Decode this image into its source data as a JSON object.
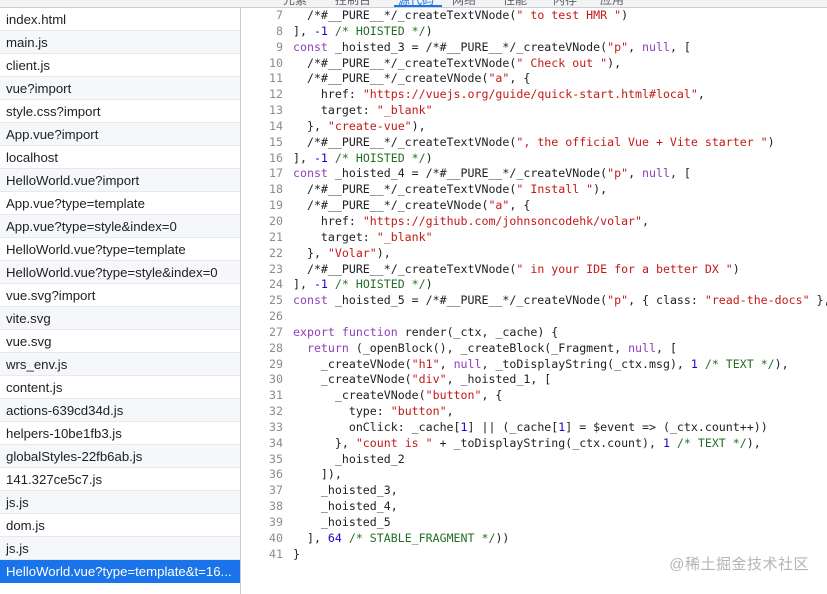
{
  "tabs": [
    {
      "label": "元素",
      "active": false
    },
    {
      "label": "控制台",
      "active": false
    },
    {
      "label": "源代码",
      "active": true
    },
    {
      "label": "网络",
      "active": false
    },
    {
      "label": "性能",
      "active": false
    },
    {
      "label": "内存",
      "active": false
    },
    {
      "label": "应用",
      "active": false
    }
  ],
  "sidebar": {
    "files": [
      "index.html",
      "main.js",
      "client.js",
      "vue?import",
      "style.css?import",
      "App.vue?import",
      "localhost",
      "HelloWorld.vue?import",
      "App.vue?type=template",
      "App.vue?type=style&index=0",
      "HelloWorld.vue?type=template",
      "HelloWorld.vue?type=style&index=0",
      "vue.svg?import",
      "vite.svg",
      "vue.svg",
      "wrs_env.js",
      "content.js",
      "actions-639cd34d.js",
      "helpers-10be1fb3.js",
      "globalStyles-22fb6ab.js",
      "141.327ce5c7.js",
      "js.js",
      "dom.js",
      "js.js",
      "HelloWorld.vue?type=template&t=16..."
    ],
    "selected_index": 24
  },
  "editor": {
    "lines": [
      {
        "n": "7",
        "seg": [
          [
            "  /*#__PURE__*/_createTextVNode(",
            "p"
          ],
          [
            "\" to test HMR \"",
            "s"
          ],
          [
            ")",
            "p"
          ]
        ]
      },
      {
        "n": "8",
        "seg": [
          [
            "], ",
            "p"
          ],
          [
            "-1",
            "n"
          ],
          [
            " /* HOISTED */",
            "c"
          ],
          [
            ")",
            "p"
          ]
        ]
      },
      {
        "n": "9",
        "seg": [
          [
            "const",
            "k"
          ],
          [
            " _hoisted_3 = /*#__PURE__*/_createVNode(",
            "p"
          ],
          [
            "\"p\"",
            "s"
          ],
          [
            ", ",
            "p"
          ],
          [
            "null",
            "k"
          ],
          [
            ", [",
            "p"
          ]
        ]
      },
      {
        "n": "10",
        "seg": [
          [
            "  /*#__PURE__*/_createTextVNode(",
            "p"
          ],
          [
            "\" Check out \"",
            "s"
          ],
          [
            "),",
            "p"
          ]
        ]
      },
      {
        "n": "11",
        "seg": [
          [
            "  /*#__PURE__*/_createVNode(",
            "p"
          ],
          [
            "\"a\"",
            "s"
          ],
          [
            ", {",
            "p"
          ]
        ]
      },
      {
        "n": "12",
        "seg": [
          [
            "    href: ",
            "p"
          ],
          [
            "\"https://vuejs.org/guide/quick-start.html#local\"",
            "s"
          ],
          [
            ",",
            "p"
          ]
        ]
      },
      {
        "n": "13",
        "seg": [
          [
            "    target: ",
            "p"
          ],
          [
            "\"_blank\"",
            "s"
          ]
        ]
      },
      {
        "n": "14",
        "seg": [
          [
            "  }, ",
            "p"
          ],
          [
            "\"create-vue\"",
            "s"
          ],
          [
            "),",
            "p"
          ]
        ]
      },
      {
        "n": "15",
        "seg": [
          [
            "  /*#__PURE__*/_createTextVNode(",
            "p"
          ],
          [
            "\", the official Vue + Vite starter \"",
            "s"
          ],
          [
            ")",
            "p"
          ]
        ]
      },
      {
        "n": "16",
        "seg": [
          [
            "], ",
            "p"
          ],
          [
            "-1",
            "n"
          ],
          [
            " /* HOISTED */",
            "c"
          ],
          [
            ")",
            "p"
          ]
        ]
      },
      {
        "n": "17",
        "seg": [
          [
            "const",
            "k"
          ],
          [
            " _hoisted_4 = /*#__PURE__*/_createVNode(",
            "p"
          ],
          [
            "\"p\"",
            "s"
          ],
          [
            ", ",
            "p"
          ],
          [
            "null",
            "k"
          ],
          [
            ", [",
            "p"
          ]
        ]
      },
      {
        "n": "18",
        "seg": [
          [
            "  /*#__PURE__*/_createTextVNode(",
            "p"
          ],
          [
            "\" Install \"",
            "s"
          ],
          [
            "),",
            "p"
          ]
        ]
      },
      {
        "n": "19",
        "seg": [
          [
            "  /*#__PURE__*/_createVNode(",
            "p"
          ],
          [
            "\"a\"",
            "s"
          ],
          [
            ", {",
            "p"
          ]
        ]
      },
      {
        "n": "20",
        "seg": [
          [
            "    href: ",
            "p"
          ],
          [
            "\"https://github.com/johnsoncodehk/volar\"",
            "s"
          ],
          [
            ",",
            "p"
          ]
        ]
      },
      {
        "n": "21",
        "seg": [
          [
            "    target: ",
            "p"
          ],
          [
            "\"_blank\"",
            "s"
          ]
        ]
      },
      {
        "n": "22",
        "seg": [
          [
            "  }, ",
            "p"
          ],
          [
            "\"Volar\"",
            "s"
          ],
          [
            "),",
            "p"
          ]
        ]
      },
      {
        "n": "23",
        "seg": [
          [
            "  /*#__PURE__*/_createTextVNode(",
            "p"
          ],
          [
            "\" in your IDE for a better DX \"",
            "s"
          ],
          [
            ")",
            "p"
          ]
        ]
      },
      {
        "n": "24",
        "seg": [
          [
            "], ",
            "p"
          ],
          [
            "-1",
            "n"
          ],
          [
            " /* HOISTED */",
            "c"
          ],
          [
            ")",
            "p"
          ]
        ]
      },
      {
        "n": "25",
        "seg": [
          [
            "const",
            "k"
          ],
          [
            " _hoisted_5 = /*#__PURE__*/_createVNode(",
            "p"
          ],
          [
            "\"p\"",
            "s"
          ],
          [
            ", { class: ",
            "p"
          ],
          [
            "\"read-the-docs\"",
            "s"
          ],
          [
            " },",
            "p"
          ]
        ]
      },
      {
        "n": "26",
        "seg": []
      },
      {
        "n": "27",
        "seg": [
          [
            "export",
            "k"
          ],
          [
            " ",
            "p"
          ],
          [
            "function",
            "k"
          ],
          [
            " render(_ctx, _cache) {",
            "p"
          ]
        ]
      },
      {
        "n": "28",
        "seg": [
          [
            "  ",
            "p"
          ],
          [
            "return",
            "k"
          ],
          [
            " (_openBlock(), _createBlock(_Fragment, ",
            "p"
          ],
          [
            "null",
            "k"
          ],
          [
            ", [",
            "p"
          ]
        ]
      },
      {
        "n": "29",
        "seg": [
          [
            "    _createVNode(",
            "p"
          ],
          [
            "\"h1\"",
            "s"
          ],
          [
            ", ",
            "p"
          ],
          [
            "null",
            "k"
          ],
          [
            ", _toDisplayString(_ctx.msg), ",
            "p"
          ],
          [
            "1",
            "n"
          ],
          [
            " /* TEXT */",
            "c"
          ],
          [
            "),",
            "p"
          ]
        ]
      },
      {
        "n": "30",
        "seg": [
          [
            "    _createVNode(",
            "p"
          ],
          [
            "\"div\"",
            "s"
          ],
          [
            ", _hoisted_1, [",
            "p"
          ]
        ]
      },
      {
        "n": "31",
        "seg": [
          [
            "      _createVNode(",
            "p"
          ],
          [
            "\"button\"",
            "s"
          ],
          [
            ", {",
            "p"
          ]
        ]
      },
      {
        "n": "32",
        "seg": [
          [
            "        type: ",
            "p"
          ],
          [
            "\"button\"",
            "s"
          ],
          [
            ",",
            "p"
          ]
        ]
      },
      {
        "n": "33",
        "seg": [
          [
            "        onClick: _cache[",
            "p"
          ],
          [
            "1",
            "n"
          ],
          [
            "] || (_cache[",
            "p"
          ],
          [
            "1",
            "n"
          ],
          [
            "] = $event => (_ctx.count++))",
            "p"
          ]
        ]
      },
      {
        "n": "34",
        "seg": [
          [
            "      }, ",
            "p"
          ],
          [
            "\"count is \"",
            "s"
          ],
          [
            " + _toDisplayString(_ctx.count), ",
            "p"
          ],
          [
            "1",
            "n"
          ],
          [
            " /* TEXT */",
            "c"
          ],
          [
            "),",
            "p"
          ]
        ]
      },
      {
        "n": "35",
        "seg": [
          [
            "      _hoisted_2",
            "p"
          ]
        ]
      },
      {
        "n": "36",
        "seg": [
          [
            "    ]),",
            "p"
          ]
        ]
      },
      {
        "n": "37",
        "seg": [
          [
            "    _hoisted_3,",
            "p"
          ]
        ]
      },
      {
        "n": "38",
        "seg": [
          [
            "    _hoisted_4,",
            "p"
          ]
        ]
      },
      {
        "n": "39",
        "seg": [
          [
            "    _hoisted_5",
            "p"
          ]
        ]
      },
      {
        "n": "40",
        "seg": [
          [
            "  ], ",
            "p"
          ],
          [
            "64",
            "n"
          ],
          [
            " /* STABLE_FRAGMENT */",
            "c"
          ],
          [
            "))",
            "p"
          ]
        ]
      },
      {
        "n": "41",
        "seg": [
          [
            "}",
            "p"
          ]
        ]
      }
    ]
  },
  "watermark": {
    "text": "@稀土掘金技术社区"
  }
}
